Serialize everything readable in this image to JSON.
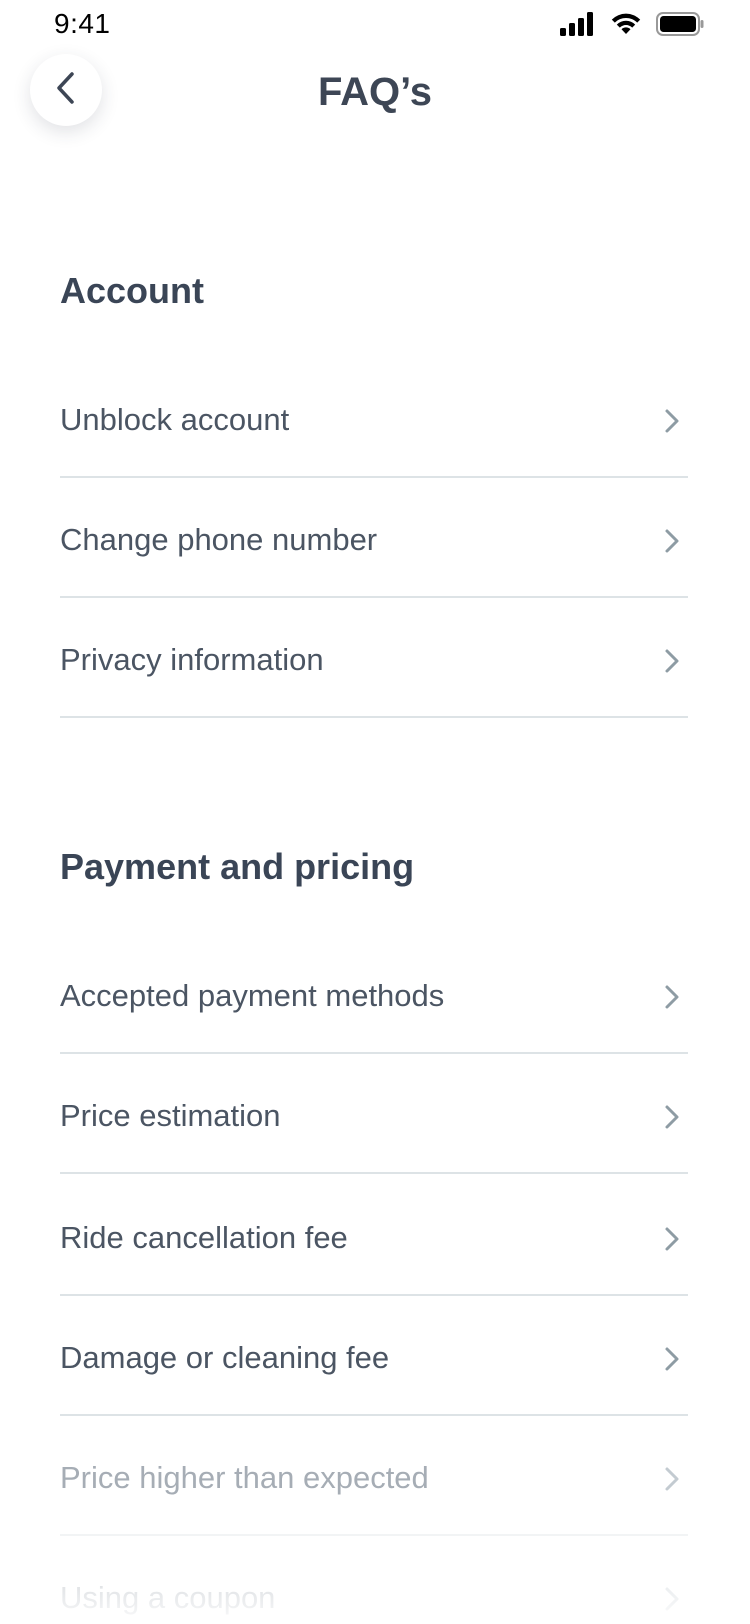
{
  "status_bar": {
    "time": "9:41"
  },
  "header": {
    "title": "FAQ’s"
  },
  "sections": [
    {
      "heading": "Account",
      "items": [
        {
          "label": "Unblock account"
        },
        {
          "label": "Change phone number"
        },
        {
          "label": "Privacy information"
        }
      ]
    },
    {
      "heading": "Payment and pricing",
      "items": [
        {
          "label": "Accepted payment methods"
        },
        {
          "label": "Price estimation"
        },
        {
          "label": "Ride cancellation fee"
        },
        {
          "label": "Damage or cleaning fee"
        },
        {
          "label": "Price higher than expected"
        },
        {
          "label": "Using a coupon"
        }
      ]
    }
  ],
  "icons": {
    "back": "chevron-left-icon",
    "item_arrow": "chevron-right-icon",
    "signal": "cellular-signal-icon",
    "wifi": "wifi-icon",
    "battery": "battery-icon"
  },
  "colors": {
    "text_primary": "#3a4556",
    "text_item": "#4b5563",
    "divider": "#dde3e6",
    "chevron": "#8e9ca4"
  }
}
